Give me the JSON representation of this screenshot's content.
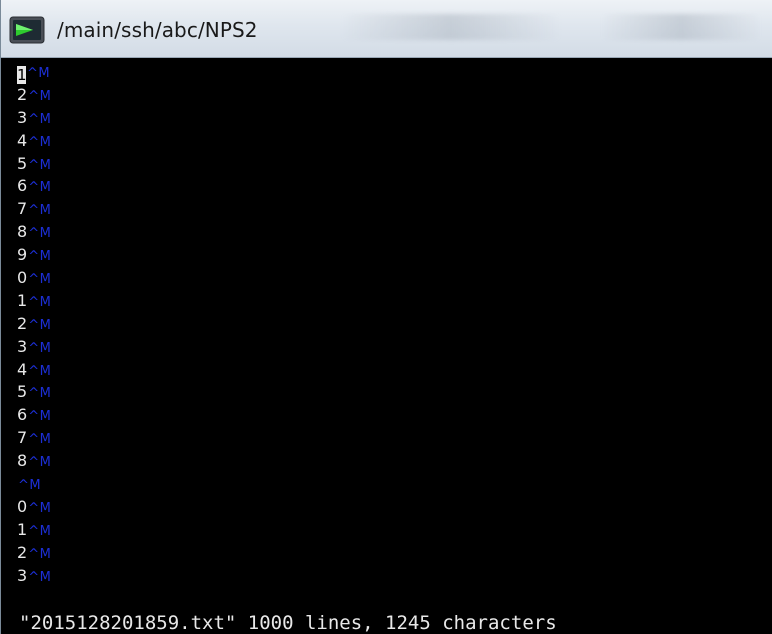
{
  "window": {
    "title": "/main/ssh/abc/NPS2",
    "icon": "terminal-icon",
    "title_bar_color": "#dfe6ee"
  },
  "terminal": {
    "background": "#000000",
    "text_color": "#e8e8e8",
    "control_char_color": "#1c2fd6",
    "lines": [
      {
        "text": "1",
        "ctrl": "^M"
      },
      {
        "text": "2",
        "ctrl": "^M"
      },
      {
        "text": "3",
        "ctrl": "^M"
      },
      {
        "text": "4",
        "ctrl": "^M"
      },
      {
        "text": "5",
        "ctrl": "^M"
      },
      {
        "text": "6",
        "ctrl": "^M"
      },
      {
        "text": "7",
        "ctrl": "^M"
      },
      {
        "text": "8",
        "ctrl": "^M"
      },
      {
        "text": "9",
        "ctrl": "^M"
      },
      {
        "text": "0",
        "ctrl": "^M"
      },
      {
        "text": "1",
        "ctrl": "^M"
      },
      {
        "text": "2",
        "ctrl": "^M"
      },
      {
        "text": "3",
        "ctrl": "^M"
      },
      {
        "text": "4",
        "ctrl": "^M"
      },
      {
        "text": "5",
        "ctrl": "^M"
      },
      {
        "text": "6",
        "ctrl": "^M"
      },
      {
        "text": "7",
        "ctrl": "^M"
      },
      {
        "text": "8",
        "ctrl": "^M"
      },
      {
        "text": "",
        "ctrl": "^M"
      },
      {
        "text": "0",
        "ctrl": "^M"
      },
      {
        "text": "1",
        "ctrl": "^M"
      },
      {
        "text": "2",
        "ctrl": "^M"
      },
      {
        "text": "3",
        "ctrl": "^M"
      }
    ],
    "status_line": "\"2015128201859.txt\" 1000 lines, 1245 characters"
  }
}
